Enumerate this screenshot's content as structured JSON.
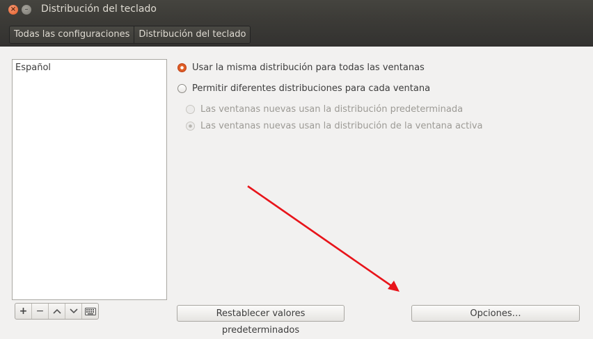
{
  "window": {
    "title": "Distribución del teclado"
  },
  "breadcrumb": [
    "Todas las configuraciones",
    "Distribución del teclado"
  ],
  "layouts": [
    "Español"
  ],
  "list_toolbar": {
    "add": "+",
    "remove": "−",
    "up": "^",
    "down": "v",
    "keyboard": "⌨"
  },
  "options": {
    "same_layout": "Usar la misma distribución para todas las ventanas",
    "different_layout": "Permitir diferentes distribuciones para cada ventana",
    "sub_default": "Las ventanas nuevas usan la distribución predeterminada",
    "sub_active": "Las ventanas nuevas usan la distribución de la ventana activa"
  },
  "buttons": {
    "reset": "Restablecer valores predeterminados",
    "options": "Opciones…"
  },
  "accent_color": "#e4642a"
}
